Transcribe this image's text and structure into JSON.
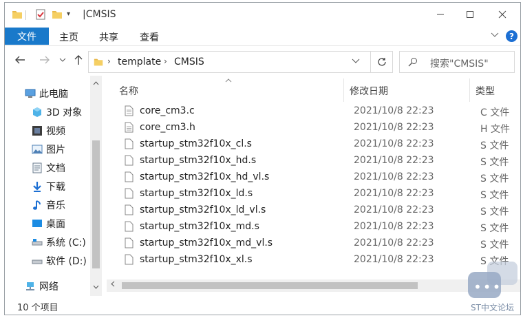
{
  "window": {
    "title": "CMSIS",
    "title_sep": "|",
    "minimize_icon": "minimize-icon",
    "maximize_icon": "maximize-icon",
    "close_icon": "close-icon"
  },
  "ribbon": {
    "file": "文件",
    "home": "主页",
    "share": "共享",
    "view": "查看"
  },
  "address": {
    "crumbs": [
      "template",
      "CMSIS"
    ]
  },
  "search": {
    "placeholder": "搜索\"CMSIS\""
  },
  "nav_pane": {
    "items": [
      {
        "label": "此电脑",
        "icon": "pc-icon"
      },
      {
        "label": "3D 对象",
        "icon": "3d-objects-icon"
      },
      {
        "label": "视频",
        "icon": "video-icon"
      },
      {
        "label": "图片",
        "icon": "pictures-icon"
      },
      {
        "label": "文档",
        "icon": "documents-icon"
      },
      {
        "label": "下载",
        "icon": "download-icon"
      },
      {
        "label": "音乐",
        "icon": "music-icon"
      },
      {
        "label": "桌面",
        "icon": "desktop-icon"
      },
      {
        "label": "系统 (C:)",
        "icon": "drive-c-icon"
      },
      {
        "label": "软件 (D:)",
        "icon": "drive-d-icon"
      },
      {
        "label": "网络",
        "icon": "network-icon"
      }
    ]
  },
  "columns": {
    "name": "名称",
    "date": "修改日期",
    "type": "类型"
  },
  "files": [
    {
      "name": "core_cm3.c",
      "date": "2021/10/8 22:23",
      "type": "C 文件"
    },
    {
      "name": "core_cm3.h",
      "date": "2021/10/8 22:23",
      "type": "H 文件"
    },
    {
      "name": "startup_stm32f10x_cl.s",
      "date": "2021/10/8 22:23",
      "type": "S 文件"
    },
    {
      "name": "startup_stm32f10x_hd.s",
      "date": "2021/10/8 22:23",
      "type": "S 文件"
    },
    {
      "name": "startup_stm32f10x_hd_vl.s",
      "date": "2021/10/8 22:23",
      "type": "S 文件"
    },
    {
      "name": "startup_stm32f10x_ld.s",
      "date": "2021/10/8 22:23",
      "type": "S 文件"
    },
    {
      "name": "startup_stm32f10x_ld_vl.s",
      "date": "2021/10/8 22:23",
      "type": "S 文件"
    },
    {
      "name": "startup_stm32f10x_md.s",
      "date": "2021/10/8 22:23",
      "type": "S 文件"
    },
    {
      "name": "startup_stm32f10x_md_vl.s",
      "date": "2021/10/8 22:23",
      "type": "S 文件"
    },
    {
      "name": "startup_stm32f10x_xl.s",
      "date": "2021/10/8 22:23",
      "type": "S 文件"
    }
  ],
  "status": {
    "count": "10 个项目"
  },
  "watermark": {
    "text": "ST中文论坛"
  },
  "colors": {
    "accent": "#1979ca",
    "folder": "#e8b84a"
  }
}
